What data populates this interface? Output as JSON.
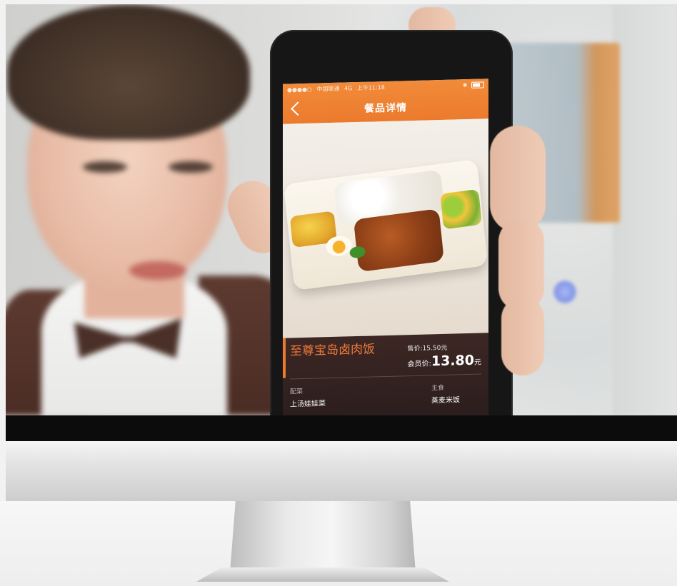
{
  "status_bar": {
    "carrier": "中国联通",
    "network": "4G",
    "time": "上午11:18"
  },
  "nav": {
    "title": "餐品详情",
    "back_icon": "chevron-left-icon"
  },
  "product": {
    "name": "至尊宝岛卤肉饭",
    "sale_price": "售价:15.50元",
    "member_label": "会员价:",
    "member_price": "13.80",
    "member_unit": "元"
  },
  "details": {
    "sides_label": "配菜",
    "sides_value": "上汤娃娃菜",
    "staple_label": "主食",
    "staple_value": "蒸麦米饭"
  },
  "colors": {
    "accent": "#ec7a2d",
    "dish_name": "#f07a3a",
    "panel_bg": "#2a1d1d"
  }
}
